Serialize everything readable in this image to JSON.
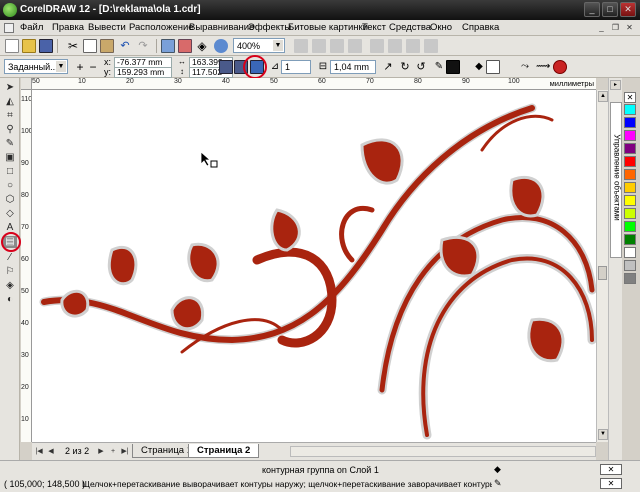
{
  "window": {
    "title": "CorelDRAW 12 - [D:\\reklama\\ola 1.cdr]",
    "controls": [
      "_",
      "□",
      "✕"
    ]
  },
  "menu": [
    "Файл",
    "Правка",
    "Вывести",
    "Расположение",
    "Выравнивание",
    "Эффекты",
    "Битовые картинки",
    "Текст",
    "Средства",
    "Окно",
    "Справка"
  ],
  "toolbar": {
    "zoom": "400%"
  },
  "properties": {
    "preset": "Заданный...",
    "x_label": "x:",
    "x_value": "-76.377 mm",
    "y_label": "y:",
    "y_value": "159.293 mm",
    "width_value": "163.399 mm",
    "height_value": "117.502 mm",
    "steps": "1",
    "offset": "1,04 mm"
  },
  "ruler": {
    "unit": "миллиметры",
    "h_ticks": [
      "50",
      "10",
      "20",
      "30",
      "40",
      "50",
      "60",
      "70",
      "80",
      "90",
      "100",
      "110"
    ],
    "v_ticks": [
      "110",
      "100",
      "90",
      "80",
      "70",
      "60",
      "50",
      "40",
      "30",
      "20",
      "10"
    ]
  },
  "docker": {
    "label": "Управление объектами"
  },
  "palette": {
    "colors": [
      "#00ffff",
      "#0000ff",
      "#ff00ff",
      "#800080",
      "#ff0000",
      "#ff6600",
      "#ffcc00",
      "#ffff00",
      "#ccff00",
      "#00ff00",
      "#008000",
      "#ffffff",
      "#c0c0c0",
      "#808080"
    ]
  },
  "artwork": {
    "fill": "#a9240f",
    "contour": "#d0d0d0"
  },
  "pages": {
    "count": "2 из 2",
    "tabs": [
      {
        "label": "Страница 1",
        "active": false
      },
      {
        "label": "Страница 2",
        "active": true
      }
    ]
  },
  "status": {
    "object_info": "контурная группа on Слой 1",
    "coords": "( 105,000; 148,500 )",
    "hint": "Щелчок+перетаскивание выворачивает контуры наружу; щелчок+перетаскивание заворачивает контуры до в середину;..."
  }
}
